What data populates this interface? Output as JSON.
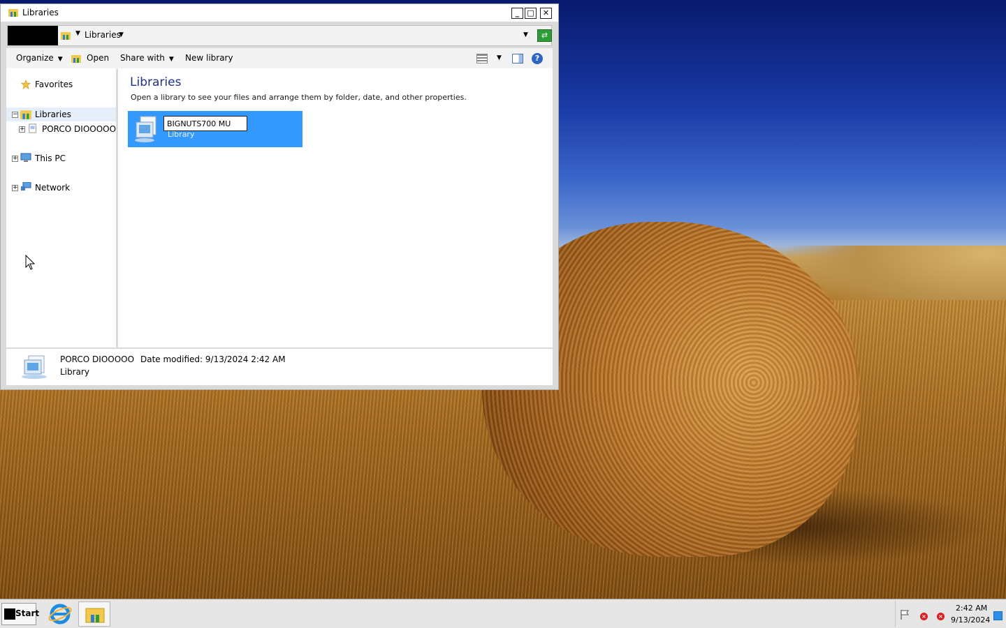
{
  "window": {
    "title": "Libraries",
    "controls": {
      "minimize": "_",
      "maximize": "□",
      "close": "✕"
    }
  },
  "address": {
    "crumb": "Libraries",
    "refresh_icon": "refresh-icon"
  },
  "toolbar": {
    "organize": "Organize",
    "open": "Open",
    "share_with": "Share with",
    "new_library": "New library"
  },
  "nav": {
    "favorites": "Favorites",
    "libraries": "Libraries",
    "library_child": "PORCO DIOOOOO",
    "this_pc": "This PC",
    "network": "Network"
  },
  "content": {
    "heading": "Libraries",
    "subtitle": "Open a library to see your files and arrange them by folder, date, and other properties.",
    "tile": {
      "rename_value": "BIGNUTS700 MU",
      "type": "Library"
    }
  },
  "details": {
    "name": "PORCO DIOOOOO",
    "modified": "Date modified: 9/13/2024 2:42 AM",
    "type": "Library"
  },
  "taskbar": {
    "start": "Start",
    "time": "2:42 AM",
    "date": "9/13/2024"
  },
  "colors": {
    "selection": "#3399ff",
    "heading": "#1e3287",
    "accent_green": "#2e9c38"
  }
}
